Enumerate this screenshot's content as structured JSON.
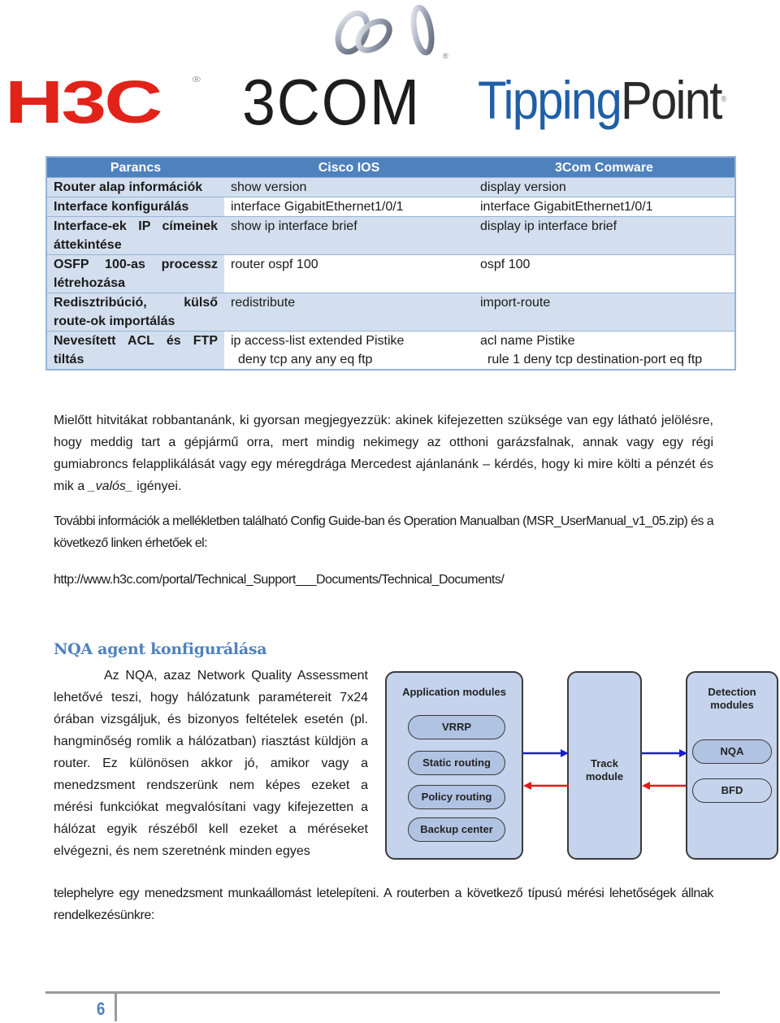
{
  "logos": {
    "h3c": "H3C",
    "threecom": "3COM",
    "tippingpoint_blue": "Tipping",
    "tippingpoint_black": "Point",
    "registered": "®"
  },
  "colors": {
    "h3c_red": "#e2231a",
    "tippingpoint_blue": "#1f5fa8",
    "table_header": "#4f81bd",
    "table_band": "#d3dfee",
    "table_border": "#95b3d7",
    "heading": "#4f81bd",
    "arrow_forward": "#1c1ccc",
    "arrow_back": "#e01b1b"
  },
  "table": {
    "headers": [
      "Parancs",
      "Cisco IOS",
      "3Com Comware"
    ],
    "rows": [
      {
        "cmd": "Router alap információk",
        "cisco": [
          "show version"
        ],
        "comware": [
          "display version"
        ]
      },
      {
        "cmd": "Interface konfigurálás",
        "cisco": [
          "interface GigabitEthernet1/0/1"
        ],
        "comware": [
          "interface GigabitEthernet1/0/1"
        ]
      },
      {
        "cmd": "Interface-ek IP címeinek áttekintése",
        "cisco": [
          "show ip interface brief"
        ],
        "comware": [
          "display ip interface brief"
        ]
      },
      {
        "cmd": "OSFP 100-as processz létrehozása",
        "cisco": [
          "router ospf 100"
        ],
        "comware": [
          "ospf 100"
        ]
      },
      {
        "cmd": "Redisztribúció, külső route-ok importálás",
        "cisco": [
          "redistribute"
        ],
        "comware": [
          "import-route"
        ]
      },
      {
        "cmd": "Nevesített ACL és FTP tiltás",
        "cisco": [
          "ip access-list extended Pistike",
          "deny tcp any any eq ftp"
        ],
        "comware": [
          "acl name Pistike",
          "rule 1 deny tcp destination-port eq ftp"
        ]
      }
    ]
  },
  "paragraphs": {
    "p1_a": "Mielőtt hitvitákat robbantanánk, ki gyorsan megjegyezzük: akinek kifejezetten szüksége van egy látható jelölésre, hogy meddig tart a gépjármű orra, mert mindig nekimegy az otthoni garázsfalnak, annak vagy egy régi gumiabroncs felapplikálását vagy egy méregdrága Mercedest ajánlanánk – kérdés, hogy ki mire költi a pénzét és mik a ",
    "p1_italic": "_valós_",
    "p1_b": " igényei.",
    "p2": "További információk a mellékletben található Config Guide-ban és Operation Manualban (MSR_UserManual_v1_05.zip) és a következő linken érhetőek el:",
    "p3_link": "http://www.h3c.com/portal/Technical_Support___Documents/Technical_Documents/"
  },
  "nqa_section": {
    "heading": "NQA agent konfigurálása",
    "column_text": "Az NQA, azaz Network Quality Assessment lehetővé teszi, hogy hálózatunk paramétereit 7x24 órában vizsgáljuk, és bizonyos feltételek esetén (pl. hangminőség romlik a hálózatban) riasztást küldjön a router. Ez különösen akkor jó, amikor vagy a menedzsment rendszerünk nem képes ezeket a mérési funkciókat megvalósítani vagy kifejezetten a hálózat egyik részéből kell ezeket a méréseket elvégezni, és nem szeretnénk minden egyes",
    "full_text": "telephelyre egy menedzsment munkaállomást letelepíteni. A routerben a következő típusú mérési lehetőségek állnak rendelkezésünkre:"
  },
  "diagram": {
    "application_title": "Application modules",
    "application_items": [
      "VRRP",
      "Static routing",
      "Policy routing",
      "Backup center"
    ],
    "track_title_1": "Track",
    "track_title_2": "module",
    "detection_title_1": "Detection",
    "detection_title_2": "modules",
    "detection_items": [
      "NQA",
      "BFD"
    ]
  },
  "footer": {
    "page_number": "6"
  }
}
